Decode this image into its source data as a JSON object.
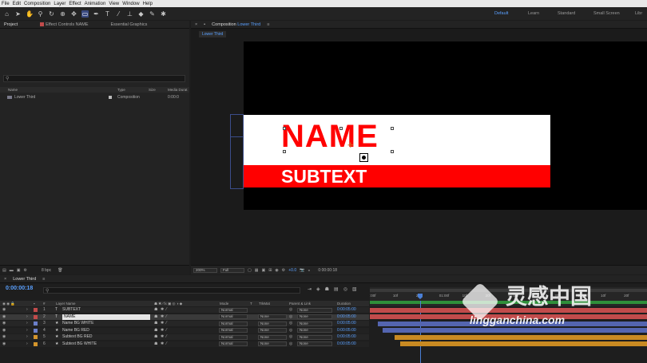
{
  "menu": [
    "File",
    "Edit",
    "Composition",
    "Layer",
    "Effect",
    "Animation",
    "View",
    "Window",
    "Help"
  ],
  "workspaces": [
    {
      "label": "Default",
      "active": true
    },
    {
      "label": "Learn",
      "active": false
    },
    {
      "label": "Standard",
      "active": false
    },
    {
      "label": "Small Screen",
      "active": false
    },
    {
      "label": "Libr",
      "active": false
    }
  ],
  "project_panel": {
    "tabs": [
      "Project",
      "Effect Controls NAME",
      "Essential Graphics"
    ],
    "columns": {
      "name": "Name",
      "type": "Type",
      "size": "Size",
      "media": "Media Durat"
    },
    "items": [
      {
        "name": "Lower Third",
        "type": "Composition",
        "duration": "0:00:0"
      }
    ],
    "bpc": "8 bpc"
  },
  "comp_panel": {
    "tab_prefix": "Composition",
    "tab_name": "Lower Third",
    "breadcrumb": "Lower Third",
    "zoom": "200%",
    "resolution": "Full",
    "exposure": "+0.0",
    "timecode": "0:00:00:18"
  },
  "canvas": {
    "title": "NAME",
    "subtitle": "SUBTEXT",
    "accent": "#ff0000"
  },
  "timeline": {
    "tab": "Lower Third",
    "timecode": "0:00:00:18",
    "columns": {
      "layer_name": "Layer Name",
      "mode": "Mode",
      "t": "T",
      "trkmat": "TrkMat",
      "parent": "Parent & Link",
      "duration": "Duration"
    },
    "ruler": [
      ":00f",
      "10f",
      "20f",
      "01:00f",
      "10f",
      "20f",
      "02:00f",
      "10f",
      "20f",
      "03:00f",
      "10f",
      "20f"
    ],
    "layers": [
      {
        "num": "1",
        "color": "#c14b4b",
        "icon": "T",
        "name": "SUBTEXT",
        "mode": "Normal",
        "trkmat": "",
        "parent": "None",
        "duration": "0:00:05:00",
        "selected": false
      },
      {
        "num": "2",
        "color": "#c14b4b",
        "icon": "T",
        "name": "NAME",
        "mode": "Normal",
        "trkmat": "None",
        "parent": "None",
        "duration": "0:00:05:00",
        "selected": true
      },
      {
        "num": "3",
        "color": "#6b7fc9",
        "icon": "★",
        "name": "Name BG WHITE",
        "mode": "Normal",
        "trkmat": "None",
        "parent": "None",
        "duration": "0:00:05:00",
        "selected": false
      },
      {
        "num": "4",
        "color": "#6b7fc9",
        "icon": "★",
        "name": "Name BG RED",
        "mode": "Normal",
        "trkmat": "None",
        "parent": "None",
        "duration": "0:00:05:00",
        "selected": false
      },
      {
        "num": "5",
        "color": "#d4952c",
        "icon": "★",
        "name": "Subtext BG RED",
        "mode": "Normal",
        "trkmat": "None",
        "parent": "None",
        "duration": "0:00:05:00",
        "selected": false
      },
      {
        "num": "6",
        "color": "#d4952c",
        "icon": "★",
        "name": "Subtext BG WHITE",
        "mode": "Normal",
        "trkmat": "None",
        "parent": "None",
        "duration": "0:00:05:00",
        "selected": false
      }
    ],
    "bar_colors": [
      "#c14b4b",
      "#c14b4b",
      "#5465b0",
      "#5465b0",
      "#c98a22",
      "#c98a22"
    ],
    "bar_starts": [
      0.0,
      0.0,
      0.03,
      0.045,
      0.09,
      0.11
    ]
  },
  "watermark": {
    "name_cn": "灵感中国",
    "url": "lingganchina.com"
  },
  "icons": [
    "home-icon",
    "selection-tool-icon",
    "hand-tool-icon",
    "zoom-tool-icon",
    "rotate-tool-icon",
    "camera-tool-icon",
    "pan-tool-icon",
    "rectangle-tool-icon",
    "pen-tool-icon",
    "type-tool-icon",
    "brush-tool-icon",
    "stamp-tool-icon",
    "eraser-tool-icon",
    "roto-tool-icon",
    "puppet-tool-icon"
  ]
}
